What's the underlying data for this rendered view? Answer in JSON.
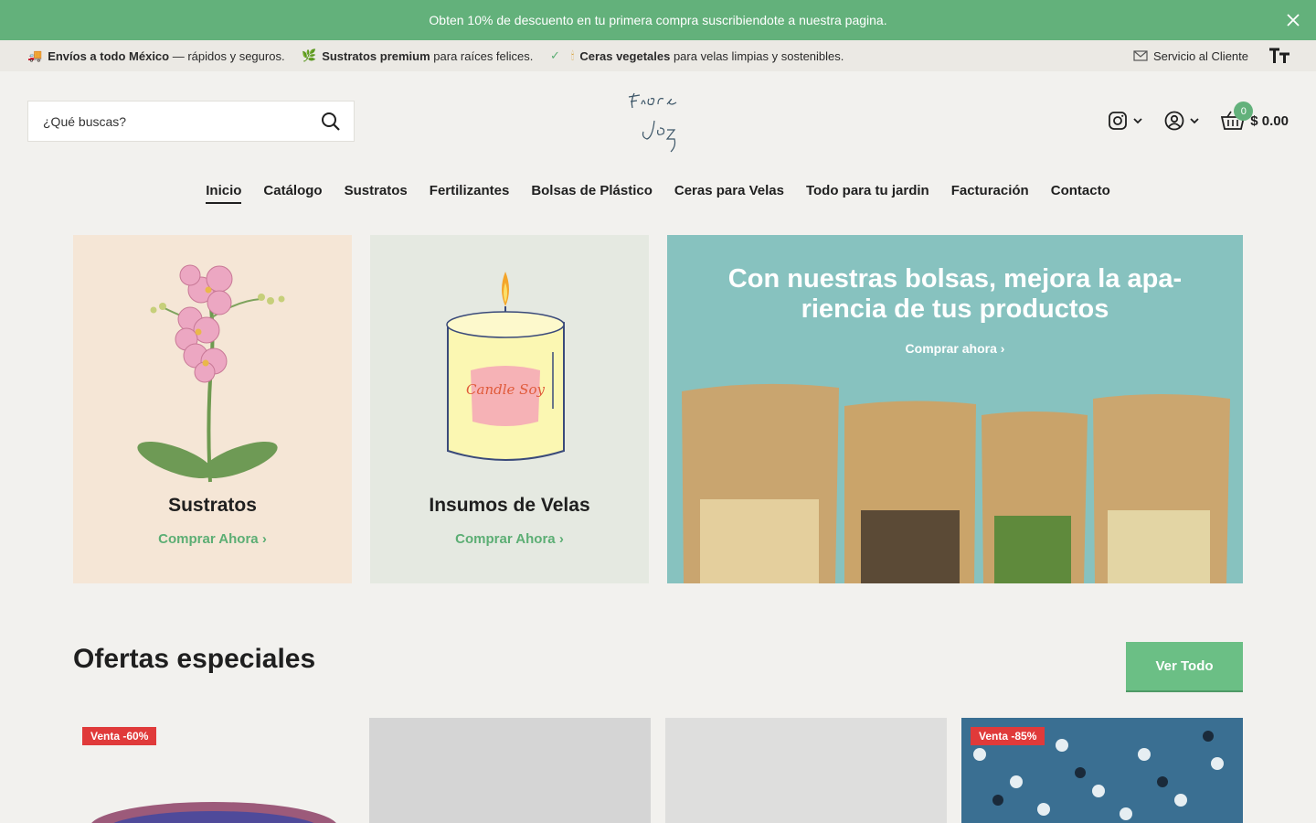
{
  "announcement": {
    "text": "Obten 10% de descuento en tu primera compra suscribiendote a nuestra pagina."
  },
  "usp_bar": {
    "items": [
      {
        "icon": "truck-icon",
        "bold": "Envíos a todo México",
        "rest": " — rápidos y seguros."
      },
      {
        "icon": "leaf-icon",
        "bold": "Sustratos premium",
        "rest": " para raíces felices."
      },
      {
        "icon": "candle-icon",
        "bold": "Ceras vegetales",
        "rest": " para velas limpias y sostenibles."
      }
    ],
    "service_label": "Servicio al Cliente"
  },
  "search": {
    "placeholder": "¿Qué buscas?"
  },
  "logo": {
    "text": "Fiore Jaz"
  },
  "cart": {
    "count": "0",
    "total": "$ 0.00"
  },
  "nav": {
    "items": [
      {
        "label": "Inicio"
      },
      {
        "label": "Catálogo"
      },
      {
        "label": "Sustratos"
      },
      {
        "label": "Fertilizantes"
      },
      {
        "label": "Bolsas de Plástico"
      },
      {
        "label": "Ceras para Velas"
      },
      {
        "label": "Todo para tu jardin"
      },
      {
        "label": "Facturación"
      },
      {
        "label": "Contacto"
      }
    ]
  },
  "tiles": [
    {
      "title": "Sustratos",
      "link": "Comprar Ahora"
    },
    {
      "title": "Insumos de Velas",
      "link": "Comprar Ahora"
    }
  ],
  "banner": {
    "title": "Con nuestras bolsas, mejora la apa-riencia de tus productos",
    "link": "Comprar ahora"
  },
  "candle_label": "Candle Soy",
  "offers": {
    "title": "Ofertas especiales",
    "button": "Ver Todo",
    "products": [
      {
        "badge": "Venta -60%"
      },
      {
        "badge": ""
      },
      {
        "badge": ""
      },
      {
        "badge": "Venta -85%"
      }
    ]
  },
  "colors": {
    "accent": "#63b17b",
    "sale": "#e03a3a",
    "banner": "#87c2bf"
  }
}
